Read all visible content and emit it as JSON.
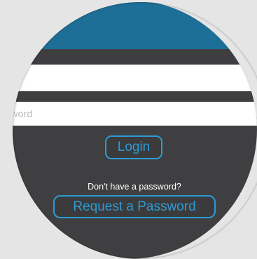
{
  "login_screen": {
    "password_placeholder": "sword",
    "login_label": "Login",
    "prompt_text": "Don't have a password?",
    "request_label": "Request a Password"
  },
  "colors": {
    "header_blue": "#1e6f98",
    "background_dark": "#3f3f41",
    "accent_blue": "#2d9bd3",
    "page_background": "#e5e5e5"
  }
}
